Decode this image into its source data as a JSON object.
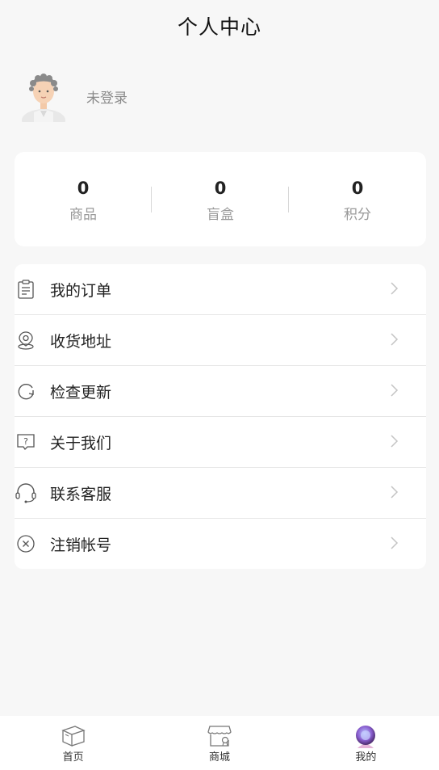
{
  "header": {
    "title": "个人中心"
  },
  "profile": {
    "login_status": "未登录"
  },
  "stats": [
    {
      "value": "0",
      "label": "商品"
    },
    {
      "value": "0",
      "label": "盲盒"
    },
    {
      "value": "0",
      "label": "积分"
    }
  ],
  "menu": [
    {
      "label": "我的订单",
      "icon": "order-clipboard-icon"
    },
    {
      "label": "收货地址",
      "icon": "location-pin-icon"
    },
    {
      "label": "检查更新",
      "icon": "refresh-icon"
    },
    {
      "label": "关于我们",
      "icon": "help-bubble-icon"
    },
    {
      "label": "联系客服",
      "icon": "headset-icon"
    },
    {
      "label": "注销帐号",
      "icon": "close-circle-icon"
    }
  ],
  "tabbar": [
    {
      "label": "首页",
      "icon": "box-icon"
    },
    {
      "label": "商城",
      "icon": "store-icon"
    },
    {
      "label": "我的",
      "icon": "profile-orb-icon"
    }
  ]
}
